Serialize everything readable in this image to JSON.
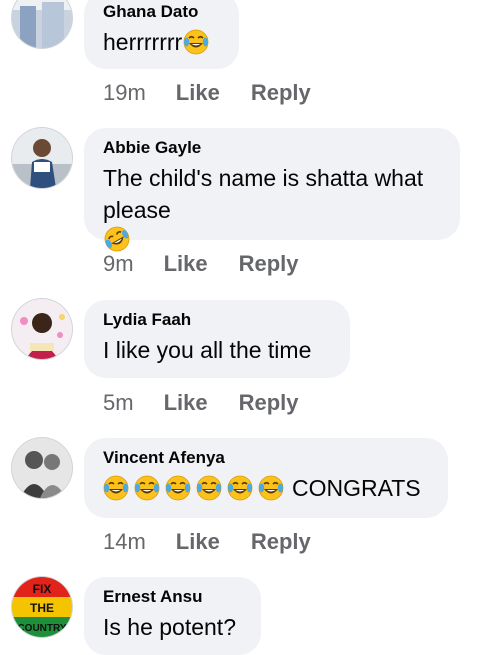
{
  "comments": [
    {
      "author": "Ghana Dato",
      "text": "herrrrrrr",
      "emoji_count": 1,
      "emoji": "face-with-tears-of-joy",
      "time": "19m",
      "like_label": "Like",
      "reply_label": "Reply"
    },
    {
      "author": "Abbie Gayle",
      "text": "The child's name is shatta what please",
      "emoji_count": 1,
      "emoji": "rolling-on-the-floor-laughing",
      "time": "9m",
      "like_label": "Like",
      "reply_label": "Reply"
    },
    {
      "author": "Lydia Faah",
      "text": "I like you all the time",
      "emoji_count": 0,
      "time": "5m",
      "like_label": "Like",
      "reply_label": "Reply"
    },
    {
      "author": "Vincent Afenya",
      "text": "CONGRATS",
      "emoji_count": 6,
      "emoji": "face-with-tears-of-joy",
      "time": "14m",
      "like_label": "Like",
      "reply_label": "Reply"
    },
    {
      "author": "Ernest Ansu",
      "text": "Is he potent?",
      "emoji_count": 0,
      "avatar_text": [
        "FIX",
        "THE",
        "COUNTRY"
      ]
    }
  ],
  "colors": {
    "bubble": "#f0f2f5",
    "meta": "#65676b",
    "text": "#050505",
    "emoji_face": "#fcc21b",
    "emoji_tears": "#4fa8e0"
  }
}
